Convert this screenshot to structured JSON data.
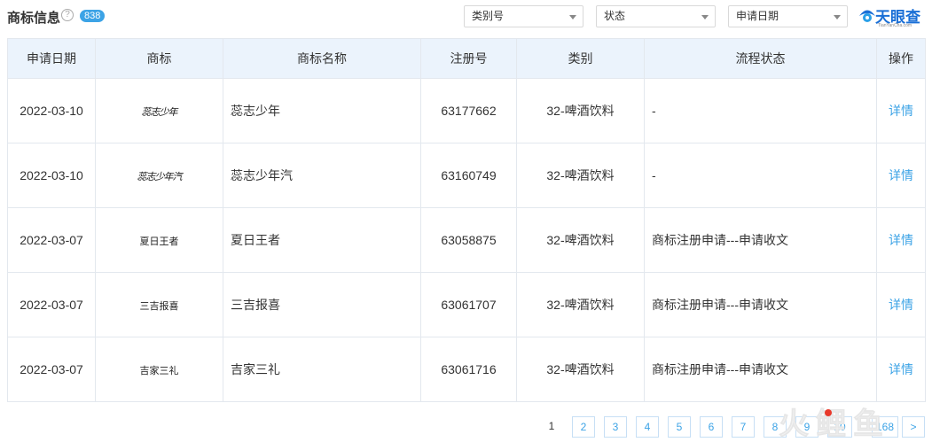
{
  "header": {
    "title": "商标信息",
    "help_icon": "question-circle-icon",
    "count": "838"
  },
  "filters": [
    {
      "label": "类别号"
    },
    {
      "label": "状态"
    },
    {
      "label": "申请日期"
    }
  ],
  "brand": {
    "name": "天眼查",
    "sub": "TianYanCha.com"
  },
  "table": {
    "columns": [
      "申请日期",
      "商标",
      "商标名称",
      "注册号",
      "类别",
      "流程状态",
      "操作"
    ],
    "rows": [
      {
        "date": "2022-03-10",
        "logo": "蕊志少年",
        "name": "蕊志少年",
        "reg": "63177662",
        "cls": "32-啤酒饮料",
        "flow": "-",
        "op": "详情"
      },
      {
        "date": "2022-03-10",
        "logo": "蕊志少年汽",
        "name": "蕊志少年汽",
        "reg": "63160749",
        "cls": "32-啤酒饮料",
        "flow": "-",
        "op": "详情"
      },
      {
        "date": "2022-03-07",
        "logo": "夏日王者",
        "name": "夏日王者",
        "reg": "63058875",
        "cls": "32-啤酒饮料",
        "flow": "商标注册申请---申请收文",
        "op": "详情"
      },
      {
        "date": "2022-03-07",
        "logo": "三吉报喜",
        "name": "三吉报喜",
        "reg": "63061707",
        "cls": "32-啤酒饮料",
        "flow": "商标注册申请---申请收文",
        "op": "详情"
      },
      {
        "date": "2022-03-07",
        "logo": "吉家三礼",
        "name": "吉家三礼",
        "reg": "63061716",
        "cls": "32-啤酒饮料",
        "flow": "商标注册申请---申请收文",
        "op": "详情"
      }
    ]
  },
  "pagination": {
    "pages": [
      "1",
      "2",
      "3",
      "4",
      "5",
      "6",
      "7",
      "8",
      "9",
      "10",
      "...",
      "168",
      ">"
    ],
    "current": "1"
  },
  "watermark": {
    "text": "火鲤鱼"
  }
}
